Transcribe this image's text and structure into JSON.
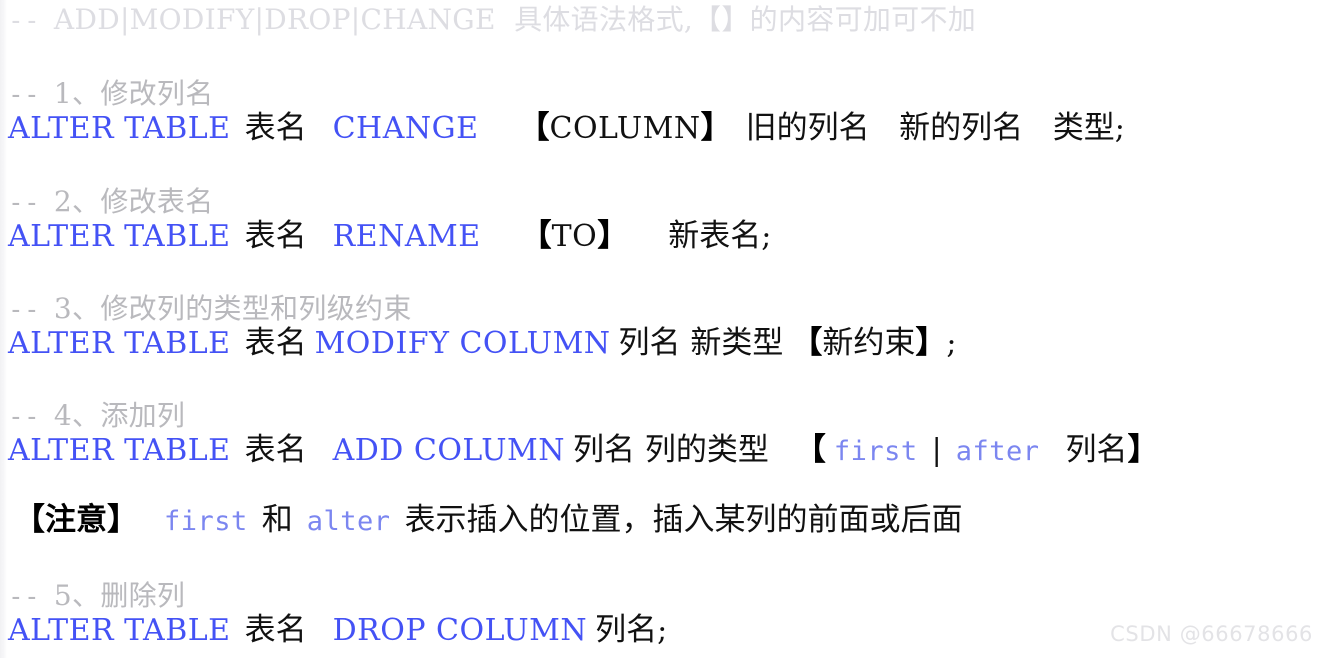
{
  "document": {
    "kind": "sql-code-snippet",
    "language": "SQL",
    "background_color": "#ffffff",
    "keyword_color": "#4452f5",
    "lowercase_keyword_color": "#7b86f0",
    "text_color": "#111111",
    "comment_color": "#b9b9bd",
    "faint_comment_color": "#dddde2"
  },
  "header_comment": {
    "dash": "--",
    "text": "ADD|MODIFY|DROP|CHANGE  具体语法格式,【】的内容可加可不加"
  },
  "sections": [
    {
      "comment_dash": "--",
      "comment_text": "1、修改列名",
      "statement": {
        "keyword1": "ALTER TABLE",
        "object": "表名",
        "keyword2": "CHANGE",
        "bracket_open": "【",
        "bracket_text": "COLUMN",
        "bracket_close": "】",
        "args": "旧的列名   新的列名   类型",
        "terminator": ";"
      }
    },
    {
      "comment_dash": "--",
      "comment_text": "2、修改表名",
      "statement": {
        "keyword1": "ALTER TABLE",
        "object": "表名",
        "keyword2": "RENAME",
        "bracket_open": "【",
        "bracket_text": "TO",
        "bracket_close": "】",
        "args": "新表名",
        "terminator": ";"
      }
    },
    {
      "comment_dash": "--",
      "comment_text": "3、修改列的类型和列级约束",
      "statement": {
        "keyword1": "ALTER TABLE",
        "object": "表名",
        "keyword2": "MODIFY COLUMN",
        "args_before": "列名 新类型",
        "bracket_open": "【",
        "bracket_text": "新约束",
        "bracket_close": "】",
        "terminator": ";"
      }
    },
    {
      "comment_dash": "--",
      "comment_text": "4、添加列",
      "statement": {
        "keyword1": "ALTER TABLE",
        "object": "表名",
        "keyword2": "ADD COLUMN",
        "args_before": "列名 列的类型",
        "bracket_open": "【",
        "option_first": "first",
        "option_sep": "|",
        "option_after": "after",
        "option_arg": "列名",
        "bracket_close": "】"
      }
    },
    {
      "comment_dash": "--",
      "comment_text": "5、删除列",
      "statement": {
        "keyword1": "ALTER TABLE",
        "object": "表名",
        "keyword2": "DROP COLUMN",
        "args": "列名",
        "terminator": ";"
      }
    }
  ],
  "note": {
    "bracket_open": "【",
    "label": "注意",
    "bracket_close": "】",
    "kw_first": "first",
    "conj": "和",
    "kw_alter": "alter",
    "text": "表示插入的位置，插入某列的前面或后面"
  },
  "watermark": {
    "text": "CSDN @66678666"
  }
}
